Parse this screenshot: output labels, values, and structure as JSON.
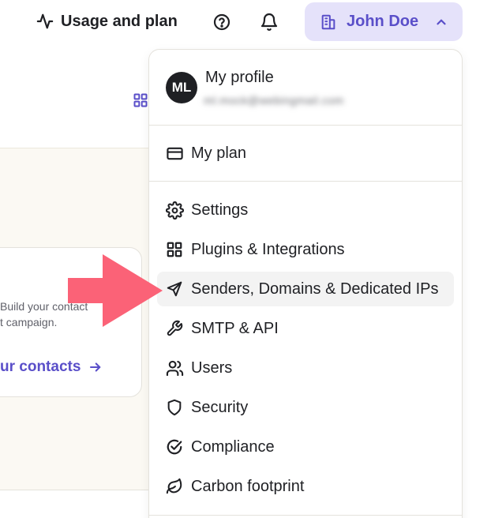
{
  "header": {
    "usage_label": "Usage and plan",
    "usage_icon": "activity-icon",
    "help_icon": "help-circle-icon",
    "notifications_icon": "bell-icon",
    "account": {
      "name": "John Doe",
      "icon": "building-icon",
      "chevron": "chevron-up-icon",
      "bg_color": "#e5e2fa",
      "text_color": "#5a4fc9"
    }
  },
  "background": {
    "card_text": "Build your contact\nt campaign.",
    "card_link": "ur contacts"
  },
  "dropdown": {
    "profile": {
      "initials": "ML",
      "title": "My profile",
      "email": "ml.mock@webingmail.com"
    },
    "plan": {
      "label": "My plan",
      "icon": "credit-card-icon"
    },
    "items": [
      {
        "label": "Settings",
        "icon": "gear-icon"
      },
      {
        "label": "Plugins & Integrations",
        "icon": "grid-icon"
      },
      {
        "label": "Senders, Domains & Dedicated IPs",
        "icon": "send-icon",
        "highlighted": true
      },
      {
        "label": "SMTP & API",
        "icon": "wrench-icon"
      },
      {
        "label": "Users",
        "icon": "users-icon"
      },
      {
        "label": "Security",
        "icon": "shield-icon"
      },
      {
        "label": "Compliance",
        "icon": "check-circle-icon"
      },
      {
        "label": "Carbon footprint",
        "icon": "leaf-icon"
      }
    ]
  },
  "annotation": {
    "arrow_color": "#fb6277"
  }
}
